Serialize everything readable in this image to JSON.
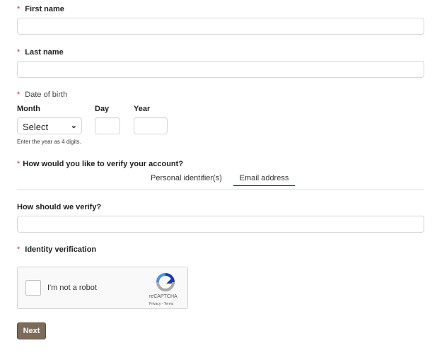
{
  "form": {
    "required_mark": "*",
    "first_name": {
      "label": "First name",
      "value": ""
    },
    "last_name": {
      "label": "Last name",
      "value": ""
    },
    "dob": {
      "label": "Date of birth",
      "month_label": "Month",
      "month_value": "Select",
      "day_label": "Day",
      "year_label": "Year",
      "hint": "Enter the year as 4 digits."
    },
    "verify_method": {
      "label": "How would you like to verify your account?",
      "tabs": [
        {
          "label": "Personal identifier(s)",
          "active": false
        },
        {
          "label": "Email address",
          "active": true
        }
      ]
    },
    "how_verify": {
      "label": "How should we verify?",
      "value": ""
    },
    "identity": {
      "label": "Identity verification"
    },
    "captcha": {
      "checkbox_label": "I'm not a robot",
      "brand": "reCAPTCHA",
      "privacy": "Privacy",
      "separator": " - ",
      "terms": "Terms"
    },
    "next_label": "Next"
  },
  "colors": {
    "accent": "#6b1d3f",
    "button": "#7d6b5a"
  }
}
